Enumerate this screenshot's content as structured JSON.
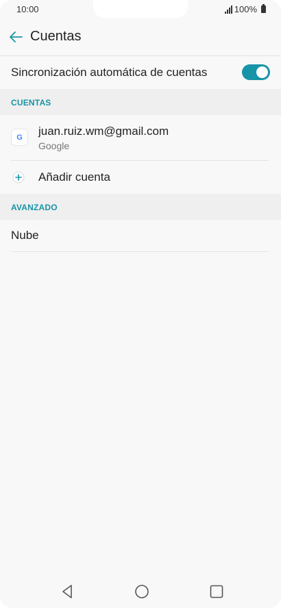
{
  "status_bar": {
    "time": "10:00",
    "battery": "100%"
  },
  "header": {
    "title": "Cuentas",
    "back_icon": "arrow-left-icon"
  },
  "auto_sync": {
    "label": "Sincronización automática de cuentas",
    "enabled": true
  },
  "sections": {
    "accounts_header": "CUENTAS",
    "advanced_header": "AVANZADO"
  },
  "accounts": [
    {
      "email": "juan.ruiz.wm@gmail.com",
      "type": "Google",
      "icon": "google-icon"
    }
  ],
  "add_account": {
    "label": "Añadir cuenta",
    "icon": "plus-circle-icon"
  },
  "advanced": {
    "cloud_label": "Nube"
  },
  "nav": {
    "back": "back-triangle-icon",
    "home": "home-circle-icon",
    "recents": "recents-square-icon"
  },
  "colors": {
    "accent": "#1794a7",
    "background": "#f8f8f8",
    "section_bg": "#efefef"
  }
}
